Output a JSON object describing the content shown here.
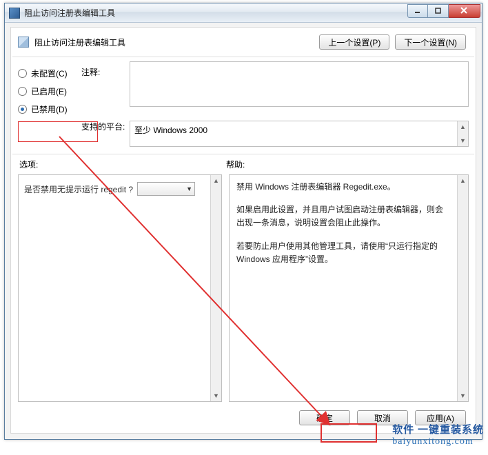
{
  "titlebar": {
    "title": "阻止访问注册表编辑工具"
  },
  "header": {
    "policy_title": "阻止访问注册表编辑工具",
    "prev_btn": "上一个设置(P)",
    "next_btn": "下一个设置(N)"
  },
  "config": {
    "radios": {
      "not_configured": "未配置(C)",
      "enabled": "已启用(E)",
      "disabled": "已禁用(D)"
    },
    "comment_label": "注释:",
    "comment_value": "",
    "platform_label": "支持的平台:",
    "platform_value": "至少 Windows 2000"
  },
  "mid": {
    "options_label": "选项:",
    "help_label": "帮助:"
  },
  "options": {
    "question": "是否禁用无提示运行 regedit ?",
    "combo_value": ""
  },
  "help": {
    "p1": "禁用 Windows 注册表编辑器 Regedit.exe。",
    "p2": "如果启用此设置，并且用户试图启动注册表编辑器，则会出现一条消息，说明设置会阻止此操作。",
    "p3": "若要防止用户使用其他管理工具，请使用“只运行指定的 Windows 应用程序”设置。"
  },
  "buttons": {
    "ok": "确定",
    "cancel": "取消",
    "apply": "应用(A)"
  },
  "watermark": {
    "text_cn": "软件 一键重装系统",
    "text_en": "baiyunxitong.com"
  }
}
